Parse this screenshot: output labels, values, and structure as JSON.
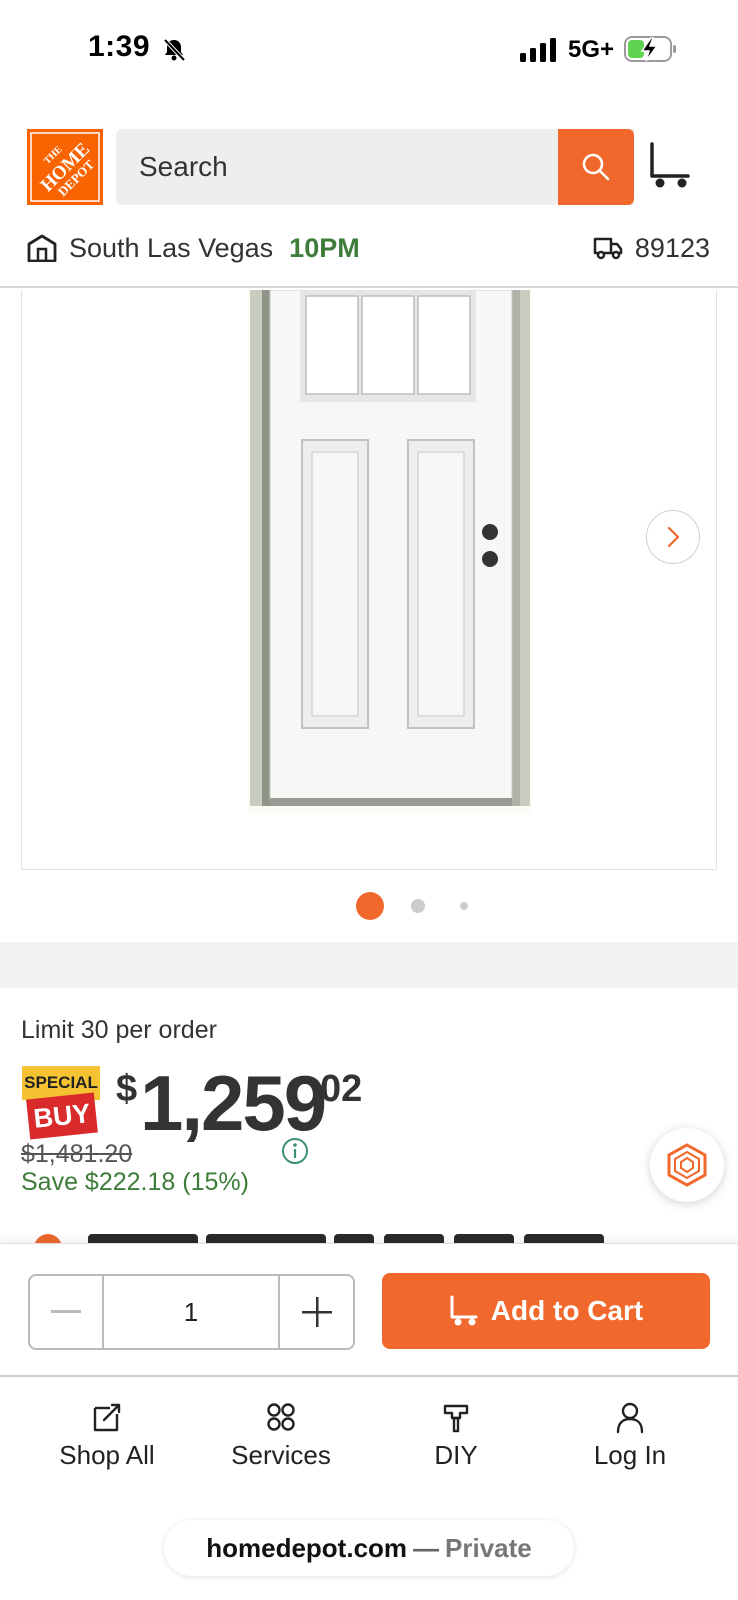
{
  "status_bar": {
    "time": "1:39",
    "network": "5G+",
    "icons": [
      "bell-slash-icon",
      "signal-icon",
      "battery-charging-icon"
    ]
  },
  "header": {
    "logo_text": "THE HOME DEPOT",
    "search_placeholder": "Search",
    "store_name": "South Las Vegas",
    "store_hours": "10PM",
    "zip": "89123",
    "brand_color": "#f96302"
  },
  "product": {
    "image_alt": "white craftsman exterior door with three-lite window",
    "gallery_dots": 3,
    "active_dot": 0
  },
  "price": {
    "limit": "Limit 30 per order",
    "badge_top": "SPECIAL",
    "badge_bottom": "BUY",
    "dollar_sign": "$",
    "dollars": "1,259",
    "cents": "02",
    "was_price": "$1,481.20",
    "savings": "Save $222.18 (15%)",
    "savings_color": "#3e7c3a"
  },
  "cart_bar": {
    "quantity": "1",
    "add_to_cart_label": "Add to Cart",
    "button_color": "#f0682b"
  },
  "bottom_nav": {
    "items": [
      {
        "label": "Shop All",
        "icon": "shop-all-icon"
      },
      {
        "label": "Services",
        "icon": "services-icon"
      },
      {
        "label": "DIY",
        "icon": "diy-hammer-icon"
      },
      {
        "label": "Log In",
        "icon": "user-icon"
      }
    ]
  },
  "browser": {
    "domain": "homedepot.com",
    "separator": "—",
    "mode": "Private"
  }
}
